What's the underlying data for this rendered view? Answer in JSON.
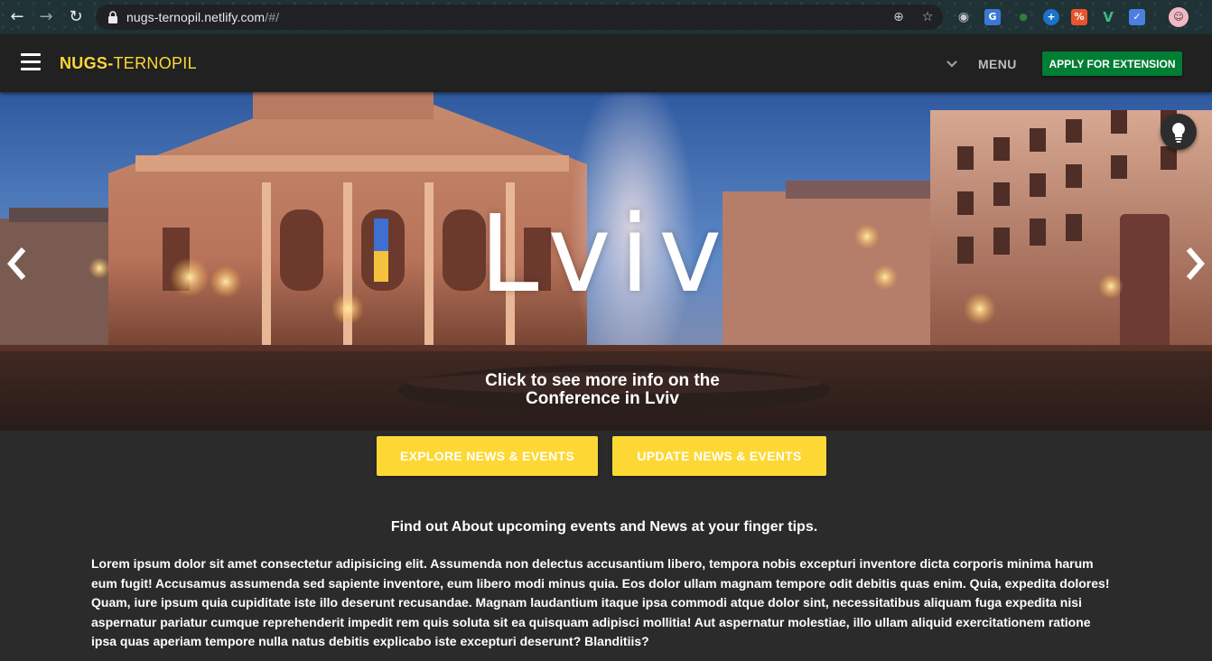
{
  "browser": {
    "url_host": "nugs-ternopil.netlify.com",
    "url_path": "/#/",
    "back_icon": "arrow-left-icon",
    "forward_icon": "arrow-right-icon",
    "reload_icon": "reload-icon",
    "lock_icon": "lock-icon",
    "add_icon": "plus-circle-icon",
    "bookmark_icon": "star-icon",
    "extensions": [
      "globe-extension-icon",
      "translate-extension-icon",
      "leaf-extension-icon",
      "blue-circle-extension-icon",
      "orange-extension-icon",
      "vue-devtools-icon",
      "blue-square-extension-icon",
      "profile-avatar-icon"
    ]
  },
  "header": {
    "brand_part1": "NUGS-",
    "brand_part2": "TERNOPIL",
    "menu_label": "MENU",
    "apply_label": "APPLY FOR EXTENSION",
    "brand_color": "#fdd835",
    "apply_color": "#007e33"
  },
  "hero": {
    "title": "Lviv",
    "caption_line1": "Click to see more info on the",
    "caption_line2": "Conference in Lviv",
    "prev_icon": "chevron-left-icon",
    "next_icon": "chevron-right-icon",
    "bulb_icon": "lightbulb-icon"
  },
  "actions": {
    "explore_label": "EXPLORE NEWS & EVENTS",
    "update_label": "UPDATE NEWS & EVENTS",
    "accent": "#fdd835"
  },
  "content": {
    "heading": "Find out About upcoming events and News at your finger tips.",
    "paragraph": "Lorem ipsum dolor sit amet consectetur adipisicing elit. Assumenda non delectus accusantium libero, tempora nobis excepturi inventore dicta corporis minima harum eum fugit! Accusamus assumenda sed sapiente inventore, eum libero modi minus quia. Eos dolor ullam magnam tempore odit debitis quas enim. Quia, expedita dolores! Quam, iure ipsum quia cupiditate iste illo deserunt recusandae. Magnam laudantium itaque ipsa commodi atque dolor sint, necessitatibus aliquam fuga expedita nisi aspernatur pariatur cumque reprehenderit impedit rem quis soluta sit ea quisquam adipisci mollitia! Aut aspernatur molestiae, illo ullam aliquid exercitationem ratione ipsa quas aperiam tempore nulla natus debitis explicabo iste excepturi deserunt? Blanditiis?"
  }
}
